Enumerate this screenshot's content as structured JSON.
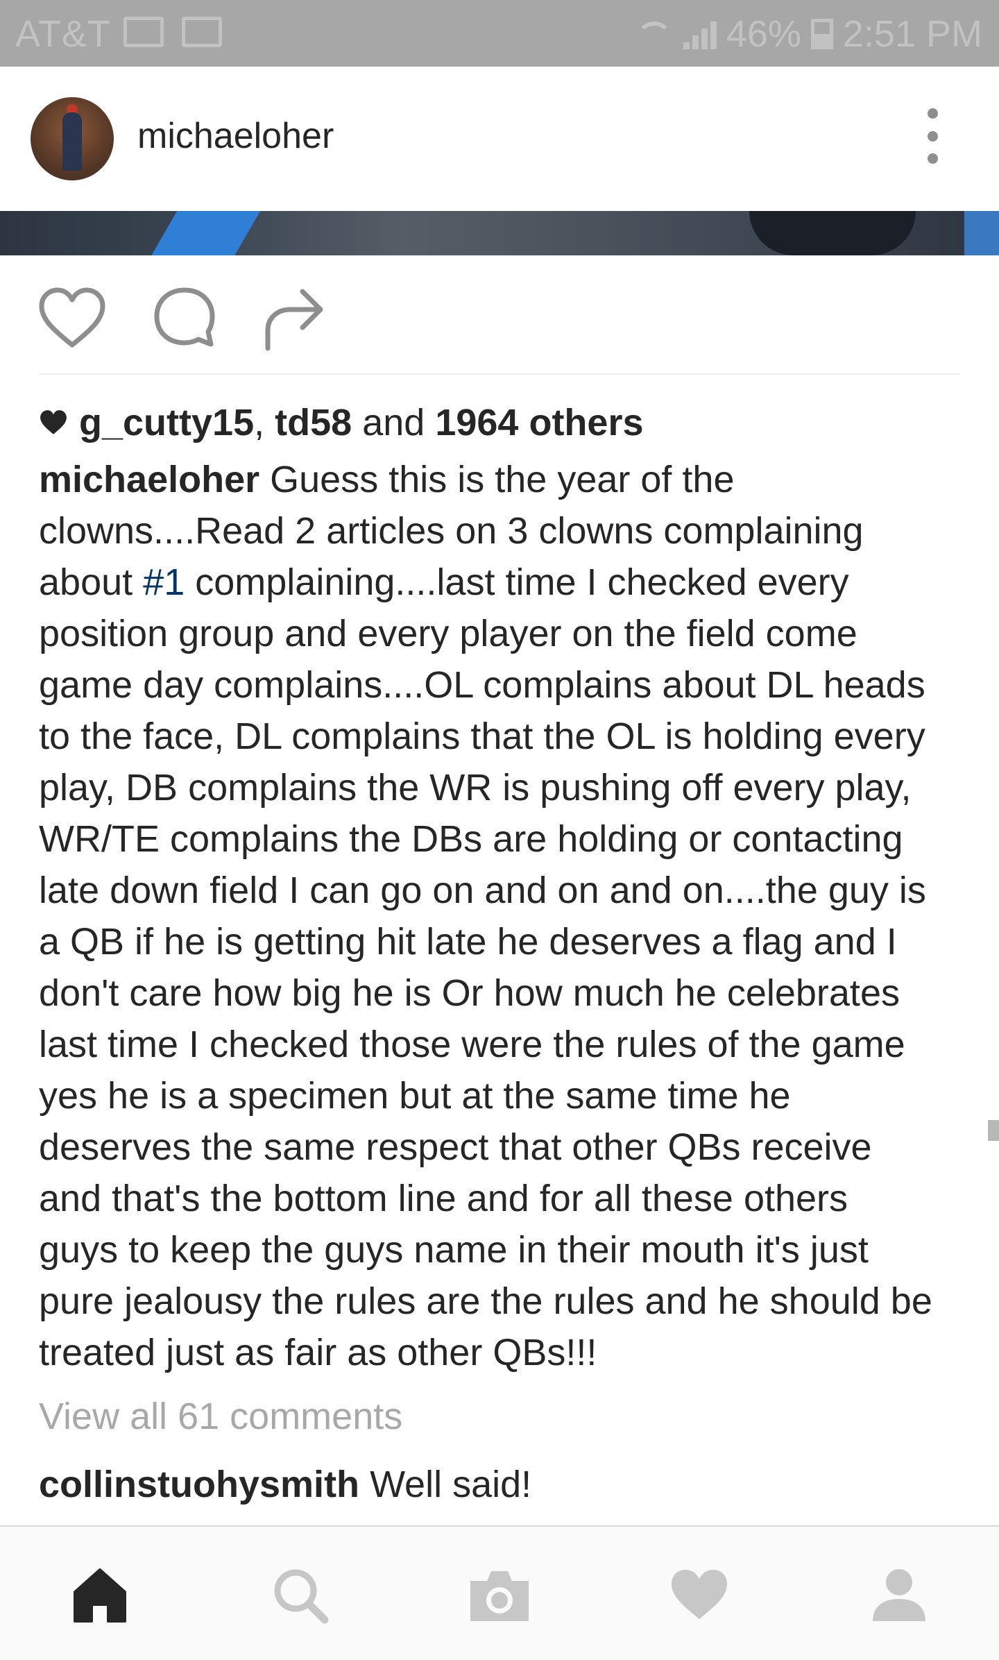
{
  "status_bar": {
    "carrier": "AT&T",
    "battery": "46%",
    "time": "2:51 PM"
  },
  "post": {
    "username": "michaeloher",
    "likes": {
      "user1": "g_cutty15",
      "separator": ",",
      "user2": "td58",
      "and_text": "and",
      "others": "1964 others"
    },
    "caption": {
      "username": "michaeloher",
      "lines": [
        "Guess this is the year of the",
        "clowns....Read 2 articles on 3 clowns complaining",
        "complaining....last time I checked every",
        "position group and every player on the field come",
        "game day complains....OL complains about DL heads",
        "to the face, DL complains that the OL is holding every",
        "play, DB complains the WR is pushing off every play,",
        "WR/TE complains the DBs are holding or contacting",
        "late down field I can go on and on and on....the guy is",
        "a QB if he is getting hit late he deserves a flag and I",
        "don't care how big he is Or how much he celebrates",
        "last time I checked those were the rules of the game",
        "yes he is a specimen but at the same time he",
        "deserves the same respect that other QBs receive",
        "and that's the bottom line and for all these others",
        "guys to keep the guys name in their mouth it's just",
        "pure jealousy the rules are the rules and he should be",
        "treated just as fair as other QBs!!!"
      ],
      "about_prefix": "about",
      "hashtag": "#1"
    },
    "view_comments": "View all 61 comments",
    "comment": {
      "username": "collinstuohysmith",
      "text": "Well said!"
    }
  },
  "colors": {
    "status_bar_bg": "#a7a7a7",
    "text": "#262626",
    "hashtag": "#003569",
    "muted": "#a8a8a8"
  },
  "icons": {
    "actions": [
      "heart-outline-icon",
      "comment-bubble-icon",
      "share-arrow-icon"
    ],
    "nav": [
      "home-icon",
      "search-icon",
      "camera-icon",
      "heart-icon",
      "profile-icon"
    ]
  }
}
